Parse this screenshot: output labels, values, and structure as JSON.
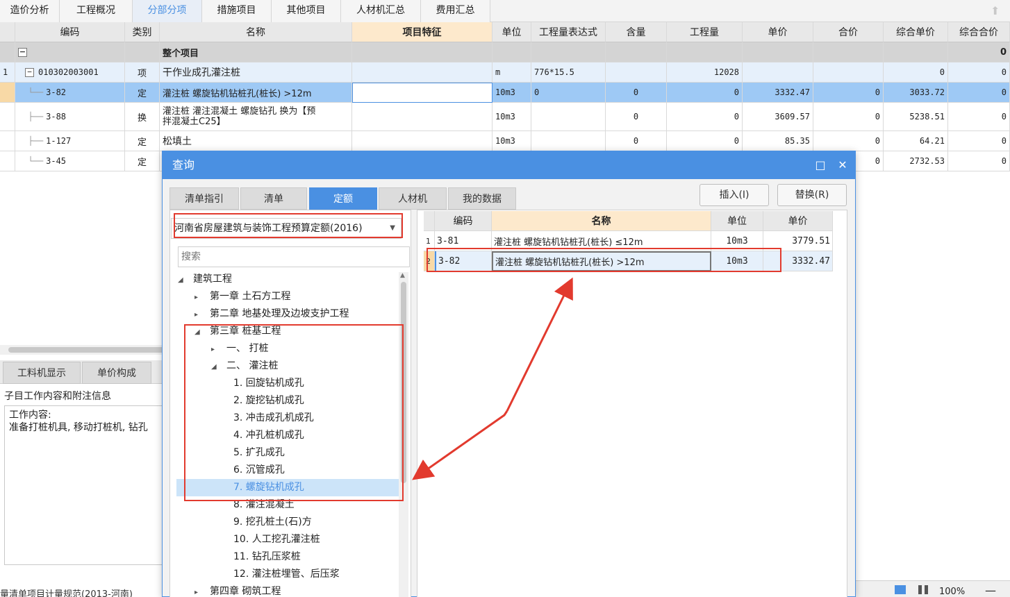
{
  "top_tabs": [
    "造价分析",
    "工程概况",
    "分部分项",
    "措施项目",
    "其他项目",
    "人材机汇总",
    "费用汇总"
  ],
  "grid": {
    "headers": [
      "编码",
      "类别",
      "名称",
      "项目特征",
      "单位",
      "工程量表达式",
      "含量",
      "工程量",
      "单价",
      "合价",
      "综合单价",
      "综合合价"
    ],
    "group_row": {
      "expander": "−",
      "name": "整个项目",
      "total": "0"
    },
    "rows": [
      {
        "num": "1",
        "expander": "−",
        "code": "010302003001",
        "type": "项",
        "name": "干作业成孔灌注桩",
        "feature": "",
        "unit": "m",
        "expr": "776*15.5",
        "content": "",
        "qty": "12028",
        "price": "",
        "amount": "",
        "comp_price": "0",
        "comp_amount": "0"
      },
      {
        "num": "",
        "code": "3-82",
        "type": "定",
        "name": "灌注桩 螺旋钻机钻桩孔(桩长) >12m",
        "feature": "",
        "unit": "10m3",
        "expr": "0",
        "content": "0",
        "qty": "0",
        "price": "3332.47",
        "amount": "0",
        "comp_price": "3033.72",
        "comp_amount": "0"
      },
      {
        "num": "",
        "code": "3-88",
        "type": "换",
        "name": "灌注桩 灌注混凝土 螺旋钻孔  换为【预拌混凝土C25】",
        "name_line1": "灌注桩 灌注混凝土 螺旋钻孔  换为【预",
        "name_line2": "拌混凝土C25】",
        "feature": "",
        "unit": "10m3",
        "expr": "",
        "content": "0",
        "qty": "0",
        "price": "3609.57",
        "amount": "0",
        "comp_price": "5238.51",
        "comp_amount": "0"
      },
      {
        "num": "",
        "code": "1-127",
        "type": "定",
        "name": "松填土",
        "feature": "",
        "unit": "10m3",
        "expr": "",
        "content": "0",
        "qty": "0",
        "price": "85.35",
        "amount": "0",
        "comp_price": "64.21",
        "comp_amount": "0"
      },
      {
        "num": "",
        "code": "3-45",
        "type": "定",
        "name": "",
        "feature": "",
        "unit": "",
        "expr": "",
        "content": "",
        "qty": "",
        "price": "",
        "amount": "0",
        "comp_price": "2732.53",
        "comp_amount": "0"
      }
    ]
  },
  "lower_panel": {
    "tabs": [
      "工料机显示",
      "单价构成"
    ],
    "title": "子目工作内容和附注信息",
    "content_label": "工作内容:",
    "content_text": "准备打桩机具, 移动打桩机, 钻孔",
    "status_text": "量清单项目计量规范(2013-河南)"
  },
  "dialog": {
    "title": "查询",
    "maximize_icon": "□",
    "close_icon": "✕",
    "tabs": [
      "清单指引",
      "清单",
      "定额",
      "人材机",
      "我的数据"
    ],
    "active_tab": "定额",
    "insert_button": "插入(I)",
    "replace_button": "替换(R)",
    "quota_library": "河南省房屋建筑与装饰工程预算定额(2016)",
    "search_placeholder": "搜索",
    "tree": [
      {
        "level": 0,
        "arrow": "◢",
        "label": "建筑工程"
      },
      {
        "level": 1,
        "arrow": "▸",
        "label": "第一章 土石方工程"
      },
      {
        "level": 1,
        "arrow": "▸",
        "label": "第二章 地基处理及边坡支护工程"
      },
      {
        "level": 1,
        "arrow": "◢",
        "label": "第三章 桩基工程"
      },
      {
        "level": 2,
        "arrow": "▸",
        "label": "一、 打桩"
      },
      {
        "level": 2,
        "arrow": "◢",
        "label": "二、 灌注桩"
      },
      {
        "level": 3,
        "arrow": "",
        "label": "1. 回旋钻机成孔"
      },
      {
        "level": 3,
        "arrow": "",
        "label": "2. 旋挖钻机成孔"
      },
      {
        "level": 3,
        "arrow": "",
        "label": "3. 冲击成孔机成孔"
      },
      {
        "level": 3,
        "arrow": "",
        "label": "4. 冲孔桩机成孔"
      },
      {
        "level": 3,
        "arrow": "",
        "label": "5. 扩孔成孔"
      },
      {
        "level": 3,
        "arrow": "",
        "label": "6. 沉管成孔"
      },
      {
        "level": 3,
        "arrow": "",
        "label": "7. 螺旋钻机成孔",
        "selected": true
      },
      {
        "level": 3,
        "arrow": "",
        "label": "8. 灌注混凝土"
      },
      {
        "level": 3,
        "arrow": "",
        "label": "9. 挖孔桩土(石)方"
      },
      {
        "level": 3,
        "arrow": "",
        "label": "10. 人工挖孔灌注桩"
      },
      {
        "level": 3,
        "arrow": "",
        "label": "11. 钻孔压浆桩"
      },
      {
        "level": 3,
        "arrow": "",
        "label": "12. 灌注桩埋管、后压浆"
      },
      {
        "level": 1,
        "arrow": "▸",
        "label": "第四章 砌筑工程"
      }
    ],
    "results": {
      "headers": [
        "编码",
        "名称",
        "单位",
        "单价"
      ],
      "rows": [
        {
          "num": "1",
          "code": "3-81",
          "name": "灌注桩 螺旋钻机钻桩孔(桩长) ≤12m",
          "unit": "10m3",
          "price": "3779.51"
        },
        {
          "num": "2",
          "code": "3-82",
          "name": "灌注桩 螺旋钻机钻桩孔(桩长) >12m",
          "unit": "10m3",
          "price": "3332.47",
          "selected": true
        }
      ]
    }
  },
  "status_right": {
    "zoom": "100%"
  },
  "colors": {
    "accent": "#4a90e2",
    "annotation": "#e23a2e",
    "selection": "#9ec9f5",
    "feature_header": "#fde9cc"
  }
}
